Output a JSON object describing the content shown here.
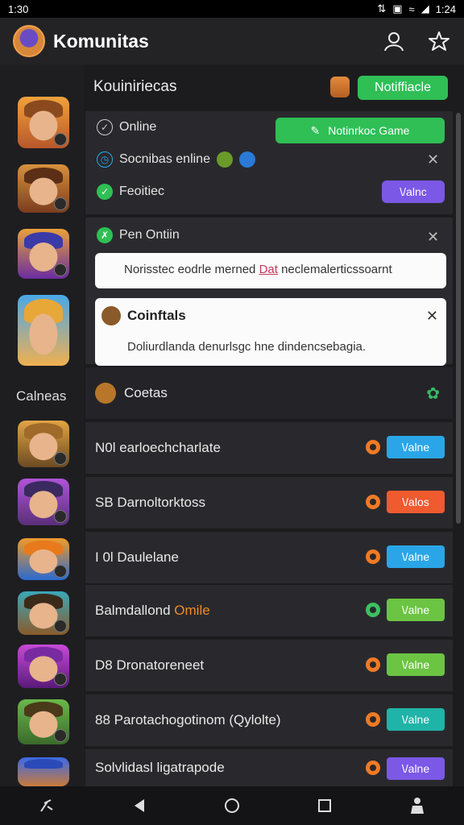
{
  "status": {
    "time_left": "1:30",
    "time_right": "1:24"
  },
  "header": {
    "title": "Komunitas"
  },
  "rail": {
    "label": "Calneas"
  },
  "section": {
    "title": "Kouiniriecas",
    "notif_button": "Notiffiacle"
  },
  "online_card": {
    "online_label": "Online",
    "game_button": "Notinrkoc Game",
    "second_label": "Socnibas enline",
    "third_label": "Feoitiec",
    "third_button": "\\/alnc"
  },
  "pen_card": {
    "title": "Pen Ontiin",
    "box1_text_a": "Norisstec eodrle merned ",
    "box1_text_hl": "Dat",
    "box1_text_b": " neclemalerticssoarnt",
    "box2_title": "Coinftals",
    "box2_body": "Doliurdlanda denurlsgc hne dindencsebagia."
  },
  "coetas": {
    "label": "Coetas"
  },
  "rows": [
    {
      "label": "N0l earloechcharlate",
      "button": "\\/alne",
      "button_color": "#2aa6e8",
      "gear_color": "#f07a26"
    },
    {
      "label": "SB Darnoltorktoss",
      "button": "\\/alos",
      "button_color": "#ef5a2f",
      "gear_color": "#f07a26"
    },
    {
      "label": "I 0l Daulelane",
      "button": "\\/alne",
      "button_color": "#2aa6e8",
      "gear_color": "#f07a26"
    },
    {
      "label_a": "Balmdallond ",
      "label_b": "Omile",
      "button": "\\/alne",
      "button_color": "#6cc443",
      "gear_color": "#3cc062"
    },
    {
      "label": "D8 Dronatoreneet",
      "button": "\\/alne",
      "button_color": "#6cc443",
      "gear_color": "#f07a26"
    },
    {
      "label": "88 Parotachogotinom (Qylolte)",
      "button": "\\/alne",
      "button_color": "#20b3a8",
      "gear_color": "#f07a26"
    },
    {
      "label": "Solvlidasl ligatrapode",
      "button": "\\/alne",
      "button_color": "#7b58e6",
      "gear_color": "#f07a26"
    }
  ],
  "icons": {
    "profile": "user-outline-icon",
    "favorite": "star-outline-icon",
    "close": "close-icon",
    "puzzle": "puzzle-icon"
  }
}
